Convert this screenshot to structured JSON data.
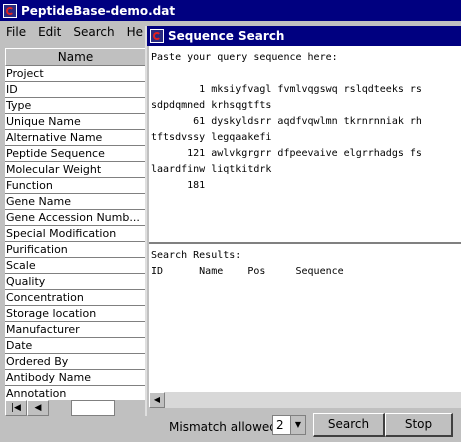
{
  "main_window": {
    "title": "PeptideBase-demo.dat",
    "menu": [
      "File",
      "Edit",
      "Search",
      "He"
    ]
  },
  "field_list": {
    "header": "Name",
    "items": [
      "Project",
      "ID",
      "Type",
      "Unique Name",
      "Alternative Name",
      "Peptide Sequence",
      "Molecular Weight",
      "Function",
      "Gene Name",
      "Gene Accession Numb...",
      "Special Modification",
      "Purification",
      "Scale",
      "Quality",
      "Concentration",
      "Storage location",
      "Manufacturer",
      "Date",
      "Ordered By",
      "Antibody Name",
      "Annotation"
    ]
  },
  "nav": {
    "first": "|◀",
    "prev": "◀"
  },
  "dialog": {
    "title": "Sequence Search",
    "query_text": "Paste your query sequence here:\n\n        1 mksiyfvagl fvmlvqgswq rslqdteeks rs\nsdpdqmned krhsqgtfts\n       61 dyskyldsrr aqdfvqwlmn tkrnrnniak rh\ntftsdvssy legqaakefi\n      121 awlvkgrgrr dfpeevaive elgrrhadgs fs\nlaardfinw liqtkitdrk\n      181",
    "results_text": "Search Results:\nID      Name    Pos     Sequence",
    "mismatch_label": "Mismatch allowed",
    "mismatch_value": "2",
    "search_label": "Search",
    "stop_label": "Stop"
  },
  "colors": {
    "titlebar": "#000080",
    "window": "#c0c0c0"
  }
}
